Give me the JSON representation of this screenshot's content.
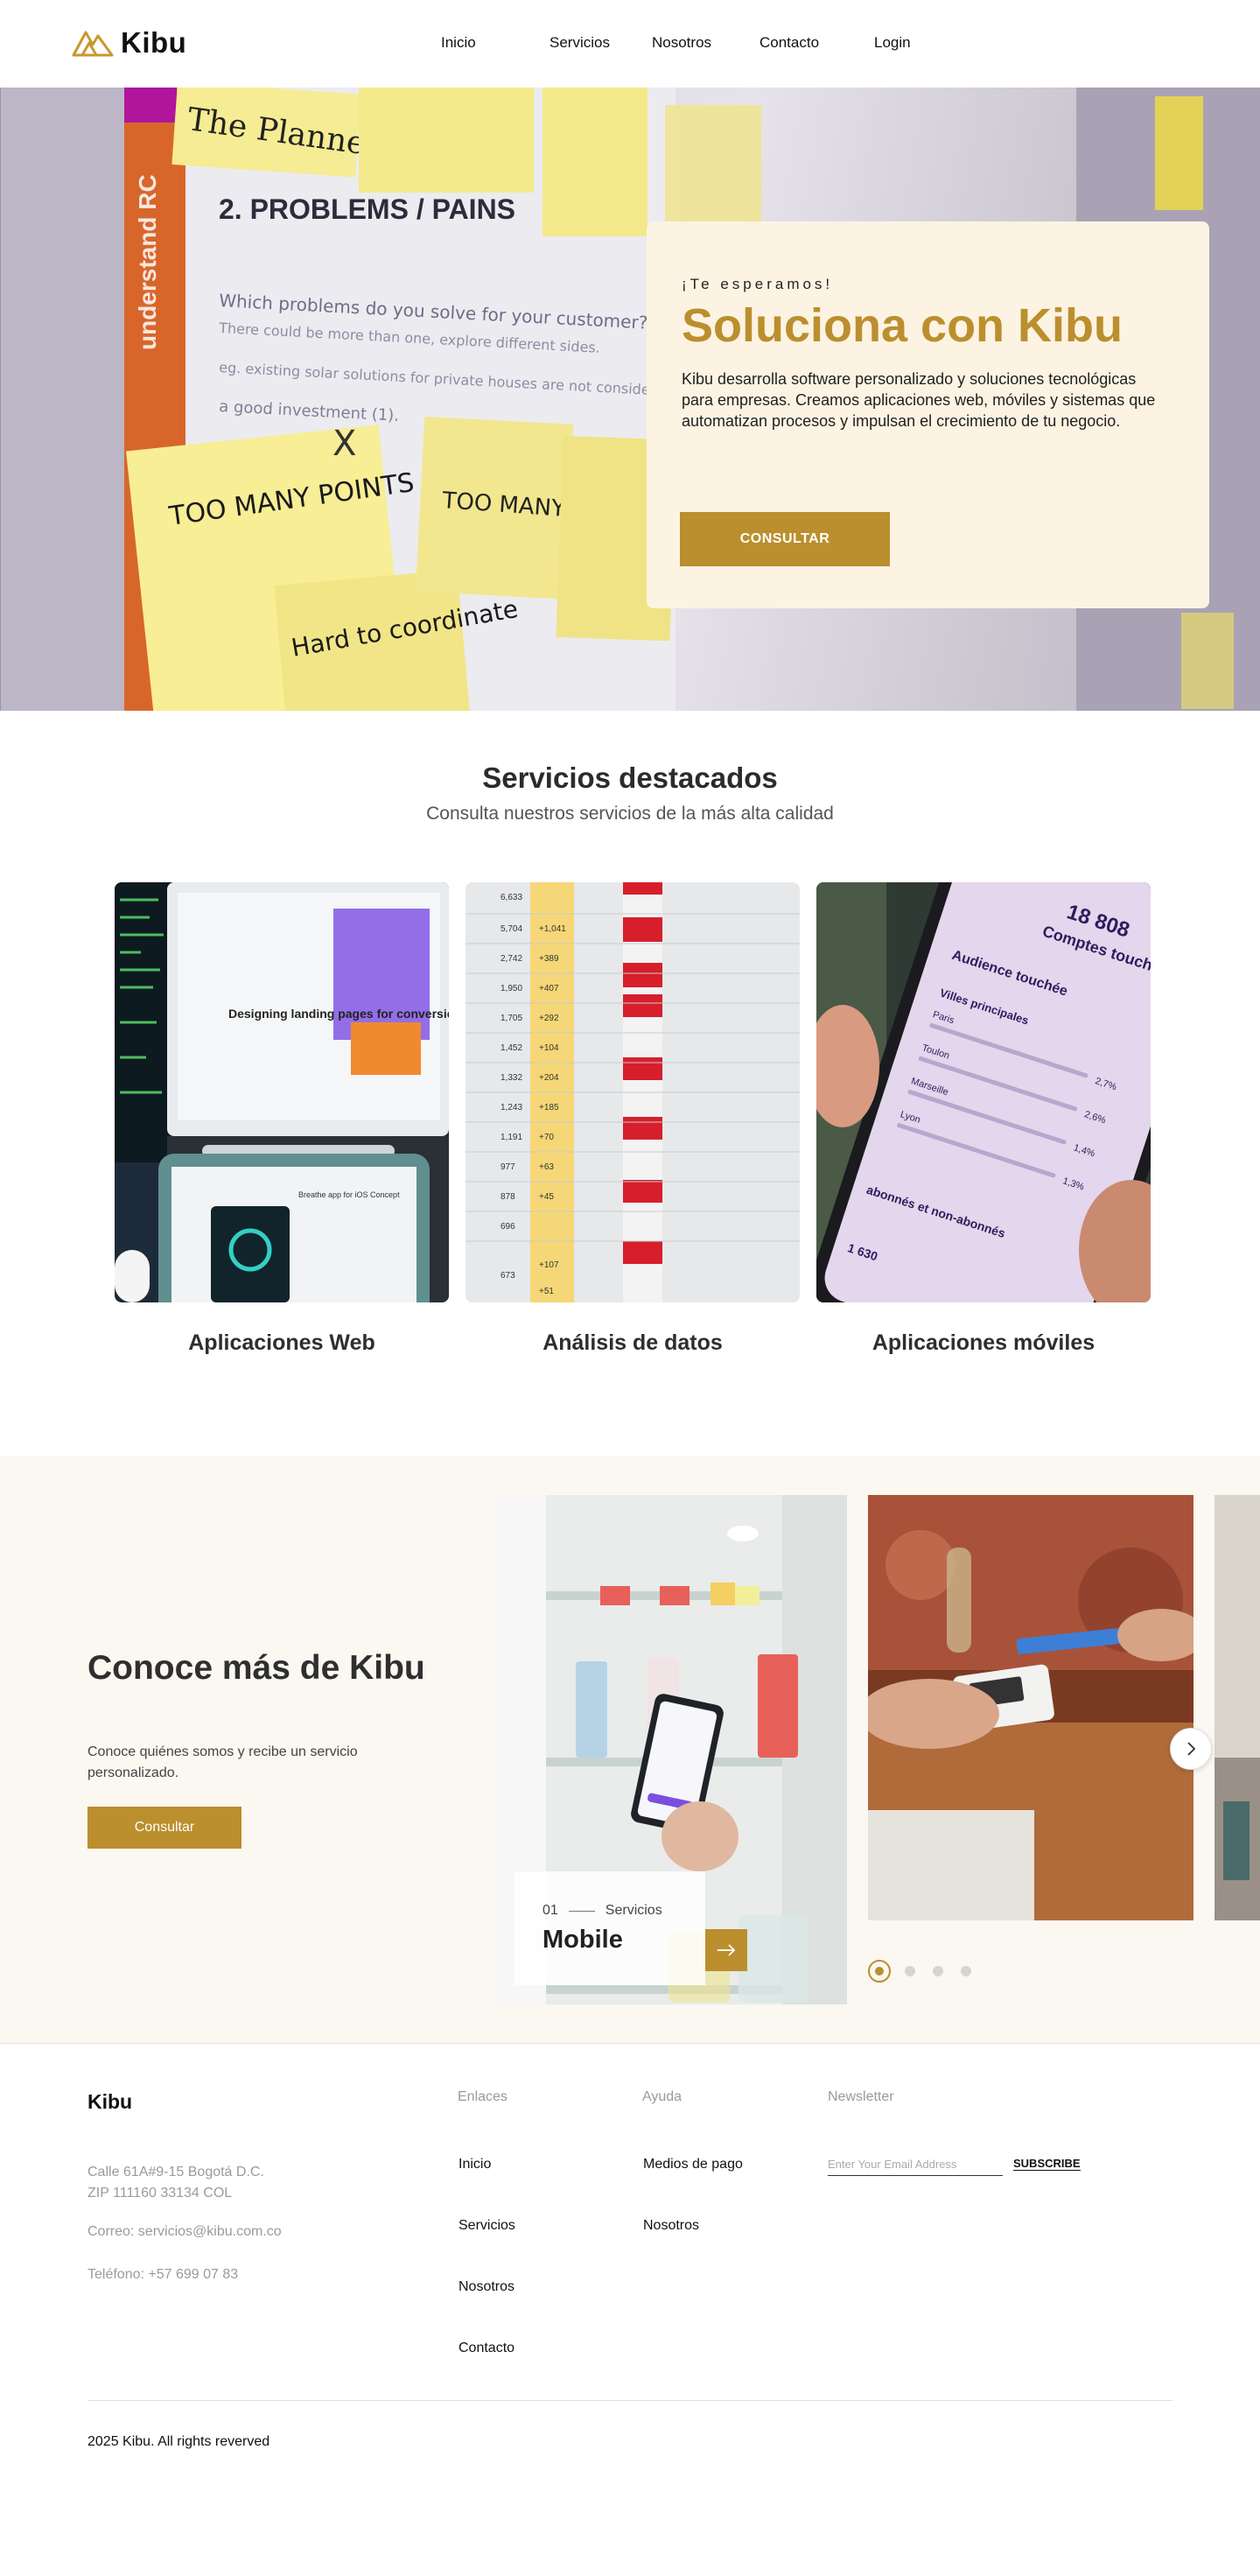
{
  "nav": {
    "brand": "Kibu",
    "links": [
      "Inicio",
      "Servicios",
      "Nosotros",
      "Contacto",
      "Login"
    ]
  },
  "hero": {
    "eyebrow": "¡Te esperamos!",
    "title": "Soluciona con Kibu",
    "description": "Kibu desarrolla software personalizado y soluciones tecnológicas para empresas. Creamos aplicaciones web, móviles y sistemas que automatizan procesos y impulsan el crecimiento de tu negocio.",
    "cta": "CONSULTAR",
    "notes": [
      "The Planner",
      "2. PROBLEMS / PAINS",
      "Which problems do you solve for your customer?",
      "There could be more than one, explore different sides.",
      "eg. existing solar solutions for private houses are not considered",
      "a good investment (1).",
      "understand RC",
      "TOO MANY POINTS FOR COMPARISON",
      "Hard to coordinate",
      "TOO MANY TABS",
      "X"
    ]
  },
  "services": {
    "title": "Servicios destacados",
    "subtitle": "Consulta nuestros servicios de la más alta calidad",
    "items": [
      {
        "label": "Aplicaciones Web",
        "image_text": [
          "Designing landing pages for conversion",
          "Breathe app for iOS Concept"
        ]
      },
      {
        "label": "Análisis de datos",
        "image_text": [
          "6,633",
          "5,704",
          "2,742",
          "1,950",
          "1,705",
          "1,452",
          "1,332",
          "1,243",
          "1,191",
          "977",
          "878",
          "696",
          "673",
          "+1,041",
          "+389",
          "+407",
          "+292",
          "+104",
          "+204",
          "+185",
          "+70",
          "+63",
          "+45",
          "+107",
          "+51"
        ]
      },
      {
        "label": "Aplicaciones móviles",
        "image_text": [
          "18 808",
          "Comptes touchés",
          "Audience touchée",
          "Villes principales",
          "Paris",
          "Toulon",
          "Marseille",
          "Lyon",
          "2,7%",
          "2,6%",
          "1,4%",
          "1,3%",
          "abonnés et non-abonnés",
          "1 630"
        ]
      }
    ]
  },
  "about": {
    "title": "Conoce más de Kibu",
    "description": "Conoce quiénes somos y recibe un servicio personalizado.",
    "cta": "Consultar",
    "slide": {
      "index": "01",
      "category": "Servicios",
      "title": "Mobile"
    },
    "dots": 4,
    "active_dot": 1
  },
  "footer": {
    "brand": "Kibu",
    "address_line1": "Calle 61A#9-15 Bogotá D.C.",
    "address_line2": "ZIP 111160 33134 COL",
    "email": "Correo: servicios@kibu.com.co",
    "phone": "Teléfono: +57 699 07 83",
    "links_heading": "Enlaces",
    "links": [
      "Inicio",
      "Servicios",
      "Nosotros",
      "Contacto"
    ],
    "help_heading": "Ayuda",
    "help": [
      "Medios de pago",
      "Nosotros"
    ],
    "newsletter_heading": "Newsletter",
    "newsletter_placeholder": "Enter Your Email Address",
    "subscribe": "SUBSCRIBE",
    "copyright": "2025 Kibu. All rights reverved"
  },
  "colors": {
    "accent": "#bb8f2e",
    "hero_card": "#fdf3e3",
    "about_bg": "#fbf7f1"
  }
}
